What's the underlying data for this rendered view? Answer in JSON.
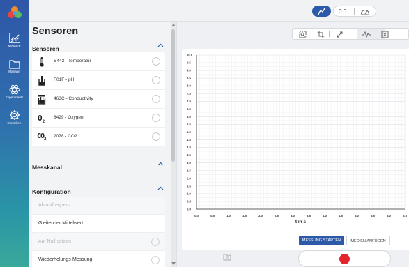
{
  "nav": {
    "items": [
      {
        "label": "Measure",
        "icon": "line-chart-icon"
      },
      {
        "label": "Manage",
        "icon": "folder-icon"
      },
      {
        "label": "Experiments",
        "icon": "atom-icon"
      },
      {
        "label": "Einstellen",
        "icon": "gear-icon"
      }
    ]
  },
  "topbar": {
    "value": "0.0",
    "graph_icon": "graph-icon",
    "gauge_icon": "gauge-icon"
  },
  "panel": {
    "title": "Sensoren",
    "sensors_section": "Sensoren",
    "sensors": [
      {
        "label": "B442 - Temperatur",
        "icon": "thermometer-icon"
      },
      {
        "label": "F01F - pH",
        "icon": "ph-probe-icon"
      },
      {
        "label": "463C - Conductivity",
        "icon": "conductivity-icon"
      },
      {
        "label": "8429 - Oxygen",
        "icon": "oxygen-icon",
        "glyph": "O",
        "sub": "2"
      },
      {
        "label": "2078 - CO2",
        "icon": "co2-icon",
        "glyph": "CO",
        "sub": "2"
      }
    ],
    "channel_section": "Messkanal",
    "config_section": "Konfiguration",
    "config": [
      {
        "label": "Abtastfrequenz",
        "disabled": true
      },
      {
        "label": "Gleitender Mittelwert",
        "disabled": false
      },
      {
        "label": "Auf Null setzen",
        "disabled": true
      },
      {
        "label": "Wiederholungs-Messung",
        "disabled": false
      }
    ]
  },
  "toolbar": {
    "icons": [
      "zoom-region-icon",
      "crop-icon",
      "expand-icon",
      "waveform-icon",
      "fit-icon"
    ]
  },
  "actions": {
    "start_label": "Messung starten",
    "media_label": "Medien anfügen",
    "record_icon": "record-icon"
  },
  "colors": {
    "accent": "#2c5aa8",
    "record": "#e3242b"
  },
  "chart_data": {
    "type": "line",
    "xlabel": "t in s",
    "ylabel": "",
    "xlim": [
      0,
      6.5
    ],
    "ylim": [
      0,
      10
    ],
    "grid": true,
    "x_ticks": [
      "0.0",
      "0.5",
      "1.0",
      "1.5",
      "2.0",
      "2.5",
      "3.0",
      "3.5",
      "4.0",
      "4.5",
      "5.0",
      "5.5",
      "6.0",
      "6.5"
    ],
    "y_ticks": [
      "0.0",
      "0.5",
      "1.0",
      "1.5",
      "2.0",
      "2.5",
      "3.0",
      "3.5",
      "4.0",
      "4.5",
      "5.0",
      "5.5",
      "6.0",
      "6.5",
      "7.0",
      "7.5",
      "8.0",
      "8.5",
      "9.0",
      "9.5",
      "10.0"
    ],
    "series": []
  }
}
